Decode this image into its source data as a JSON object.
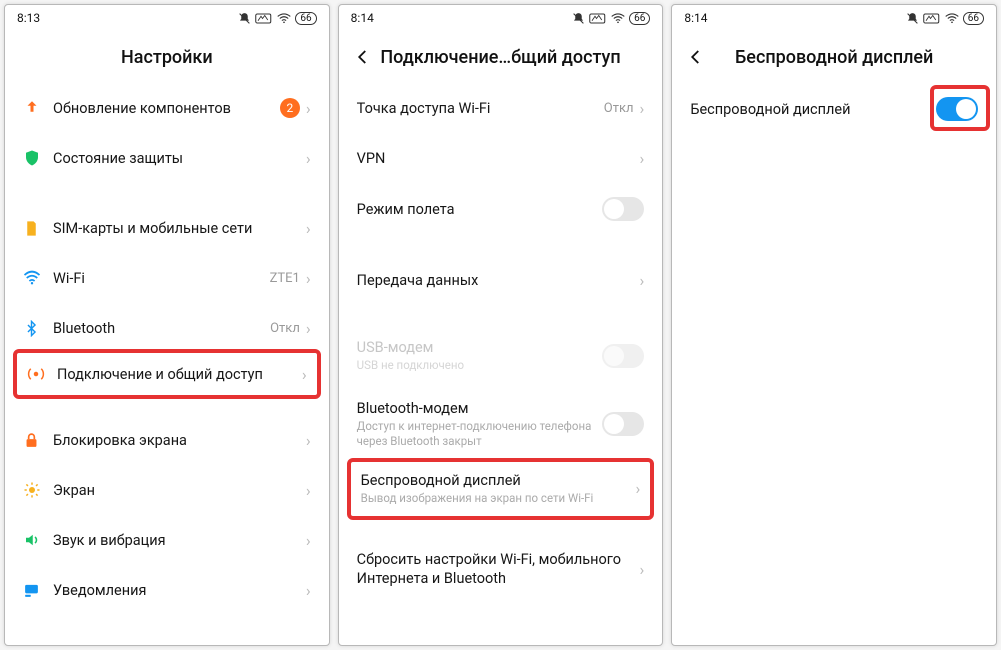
{
  "phone1": {
    "time": "8:13",
    "battery": "66",
    "title": "Настройки",
    "rows": {
      "updates": {
        "label": "Обновление компонентов",
        "badge": "2"
      },
      "security": {
        "label": "Состояние защиты"
      },
      "sim": {
        "label": "SIM-карты и мобильные сети"
      },
      "wifi": {
        "label": "Wi-Fi",
        "value": "ZTE1"
      },
      "bluetooth": {
        "label": "Bluetooth",
        "value": "Откл"
      },
      "connectivity": {
        "label": "Подключение и общий доступ"
      },
      "lock": {
        "label": "Блокировка экрана"
      },
      "display": {
        "label": "Экран"
      },
      "sound": {
        "label": "Звук и вибрация"
      },
      "notif": {
        "label": "Уведомления"
      }
    }
  },
  "phone2": {
    "time": "8:14",
    "battery": "66",
    "title": "Подключение…бщий доступ",
    "rows": {
      "hotspot": {
        "label": "Точка доступа Wi-Fi",
        "value": "Откл"
      },
      "vpn": {
        "label": "VPN"
      },
      "airplane": {
        "label": "Режим полета"
      },
      "datatrans": {
        "label": "Передача данных"
      },
      "usb": {
        "label": "USB-модем",
        "sub": "USB не подключено"
      },
      "btmodem": {
        "label": "Bluetooth-модем",
        "sub": "Доступ к интернет-подключению телефона через Bluetooth закрыт"
      },
      "wdisplay": {
        "label": "Беспроводной дисплей",
        "sub": "Вывод изображения на экран по сети Wi-Fi"
      },
      "reset": {
        "label": "Сбросить настройки Wi-Fi, мобильного Интернета и Bluetooth"
      }
    }
  },
  "phone3": {
    "time": "8:14",
    "battery": "66",
    "title": "Беспроводной дисплей",
    "rows": {
      "wdisplay": {
        "label": "Беспроводной дисплей"
      }
    }
  }
}
